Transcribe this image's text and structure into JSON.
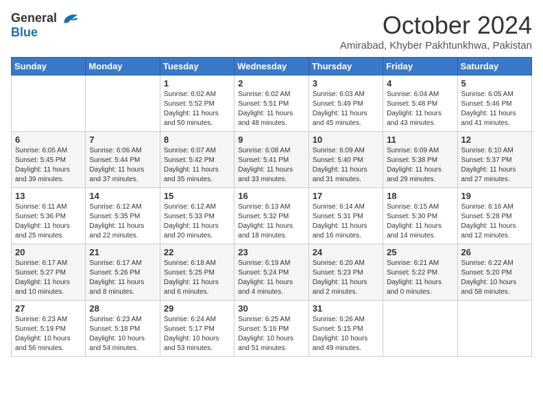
{
  "logo": {
    "general": "General",
    "blue": "Blue"
  },
  "header": {
    "month": "October 2024",
    "subtitle": "Amirabad, Khyber Pakhtunkhwa, Pakistan"
  },
  "weekdays": [
    "Sunday",
    "Monday",
    "Tuesday",
    "Wednesday",
    "Thursday",
    "Friday",
    "Saturday"
  ],
  "weeks": [
    [
      {
        "day": "",
        "content": ""
      },
      {
        "day": "",
        "content": ""
      },
      {
        "day": "1",
        "content": "Sunrise: 6:02 AM\nSunset: 5:52 PM\nDaylight: 11 hours and 50 minutes."
      },
      {
        "day": "2",
        "content": "Sunrise: 6:02 AM\nSunset: 5:51 PM\nDaylight: 11 hours and 48 minutes."
      },
      {
        "day": "3",
        "content": "Sunrise: 6:03 AM\nSunset: 5:49 PM\nDaylight: 11 hours and 45 minutes."
      },
      {
        "day": "4",
        "content": "Sunrise: 6:04 AM\nSunset: 5:48 PM\nDaylight: 11 hours and 43 minutes."
      },
      {
        "day": "5",
        "content": "Sunrise: 6:05 AM\nSunset: 5:46 PM\nDaylight: 11 hours and 41 minutes."
      }
    ],
    [
      {
        "day": "6",
        "content": "Sunrise: 6:05 AM\nSunset: 5:45 PM\nDaylight: 11 hours and 39 minutes."
      },
      {
        "day": "7",
        "content": "Sunrise: 6:06 AM\nSunset: 5:44 PM\nDaylight: 11 hours and 37 minutes."
      },
      {
        "day": "8",
        "content": "Sunrise: 6:07 AM\nSunset: 5:42 PM\nDaylight: 11 hours and 35 minutes."
      },
      {
        "day": "9",
        "content": "Sunrise: 6:08 AM\nSunset: 5:41 PM\nDaylight: 11 hours and 33 minutes."
      },
      {
        "day": "10",
        "content": "Sunrise: 6:09 AM\nSunset: 5:40 PM\nDaylight: 11 hours and 31 minutes."
      },
      {
        "day": "11",
        "content": "Sunrise: 6:09 AM\nSunset: 5:38 PM\nDaylight: 11 hours and 29 minutes."
      },
      {
        "day": "12",
        "content": "Sunrise: 6:10 AM\nSunset: 5:37 PM\nDaylight: 11 hours and 27 minutes."
      }
    ],
    [
      {
        "day": "13",
        "content": "Sunrise: 6:11 AM\nSunset: 5:36 PM\nDaylight: 11 hours and 25 minutes."
      },
      {
        "day": "14",
        "content": "Sunrise: 6:12 AM\nSunset: 5:35 PM\nDaylight: 11 hours and 22 minutes."
      },
      {
        "day": "15",
        "content": "Sunrise: 6:12 AM\nSunset: 5:33 PM\nDaylight: 11 hours and 20 minutes."
      },
      {
        "day": "16",
        "content": "Sunrise: 6:13 AM\nSunset: 5:32 PM\nDaylight: 11 hours and 18 minutes."
      },
      {
        "day": "17",
        "content": "Sunrise: 6:14 AM\nSunset: 5:31 PM\nDaylight: 11 hours and 16 minutes."
      },
      {
        "day": "18",
        "content": "Sunrise: 6:15 AM\nSunset: 5:30 PM\nDaylight: 11 hours and 14 minutes."
      },
      {
        "day": "19",
        "content": "Sunrise: 6:16 AM\nSunset: 5:28 PM\nDaylight: 11 hours and 12 minutes."
      }
    ],
    [
      {
        "day": "20",
        "content": "Sunrise: 6:17 AM\nSunset: 5:27 PM\nDaylight: 11 hours and 10 minutes."
      },
      {
        "day": "21",
        "content": "Sunrise: 6:17 AM\nSunset: 5:26 PM\nDaylight: 11 hours and 8 minutes."
      },
      {
        "day": "22",
        "content": "Sunrise: 6:18 AM\nSunset: 5:25 PM\nDaylight: 11 hours and 6 minutes."
      },
      {
        "day": "23",
        "content": "Sunrise: 6:19 AM\nSunset: 5:24 PM\nDaylight: 11 hours and 4 minutes."
      },
      {
        "day": "24",
        "content": "Sunrise: 6:20 AM\nSunset: 5:23 PM\nDaylight: 11 hours and 2 minutes."
      },
      {
        "day": "25",
        "content": "Sunrise: 6:21 AM\nSunset: 5:22 PM\nDaylight: 11 hours and 0 minutes."
      },
      {
        "day": "26",
        "content": "Sunrise: 6:22 AM\nSunset: 5:20 PM\nDaylight: 10 hours and 58 minutes."
      }
    ],
    [
      {
        "day": "27",
        "content": "Sunrise: 6:23 AM\nSunset: 5:19 PM\nDaylight: 10 hours and 56 minutes."
      },
      {
        "day": "28",
        "content": "Sunrise: 6:23 AM\nSunset: 5:18 PM\nDaylight: 10 hours and 54 minutes."
      },
      {
        "day": "29",
        "content": "Sunrise: 6:24 AM\nSunset: 5:17 PM\nDaylight: 10 hours and 53 minutes."
      },
      {
        "day": "30",
        "content": "Sunrise: 6:25 AM\nSunset: 5:16 PM\nDaylight: 10 hours and 51 minutes."
      },
      {
        "day": "31",
        "content": "Sunrise: 6:26 AM\nSunset: 5:15 PM\nDaylight: 10 hours and 49 minutes."
      },
      {
        "day": "",
        "content": ""
      },
      {
        "day": "",
        "content": ""
      }
    ]
  ]
}
